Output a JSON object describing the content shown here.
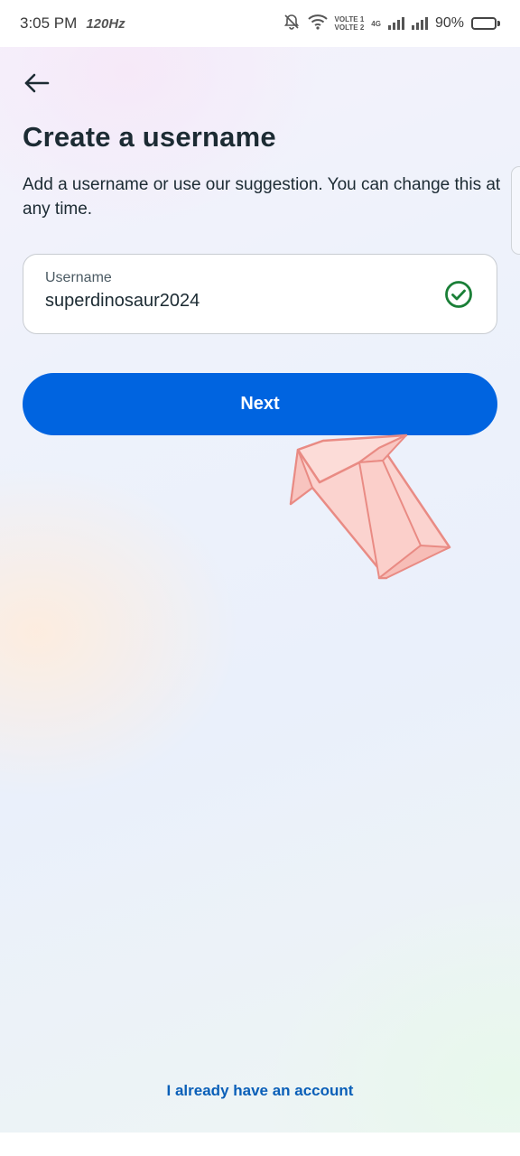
{
  "status_bar": {
    "time": "3:05 PM",
    "refresh_rate": "120Hz",
    "volte_line1": "VOLTE 1",
    "volte_line2": "VOLTE 2",
    "network": "4G",
    "battery": "90%",
    "battery_level": 0.9,
    "icons": [
      "mute-icon",
      "wifi-icon",
      "signal-icon",
      "battery-icon"
    ]
  },
  "header": {
    "back_icon": "arrow-left-icon",
    "title": "Create a username",
    "subtitle": "Add a username or use our suggestion. You can change this at any time."
  },
  "username_field": {
    "label": "Username",
    "value": "superdinosaur2024",
    "status_icon": "check-circle-icon",
    "status_color": "#1a7f37"
  },
  "next_button": {
    "label": "Next",
    "color": "#0064e0"
  },
  "footer": {
    "login_link": "I already have an account"
  },
  "colors": {
    "accent": "#0064e0",
    "text": "#1c2b33",
    "link": "#0a5fb8"
  }
}
